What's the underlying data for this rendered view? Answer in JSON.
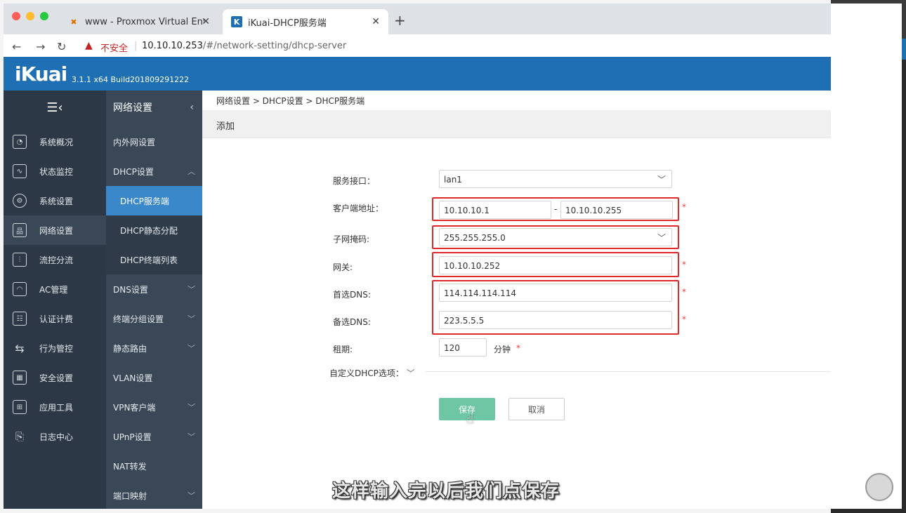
{
  "browser": {
    "tabs": [
      {
        "title": "www - Proxmox Virtual Environment",
        "active": false,
        "icon": "proxmox-icon"
      },
      {
        "title": "iKuai-DHCP服务端",
        "active": true,
        "icon": "ikuai-icon"
      }
    ],
    "insecure_label": "不安全",
    "url_host": "10.10.10.253",
    "url_path": "/#/network-setting/dhcp-server"
  },
  "app": {
    "logo": "iKuai",
    "version": "3.1.1 x64 Build201809291222"
  },
  "sidebar": {
    "main_items": [
      {
        "label": "系统概况",
        "icon": "speedometer-icon"
      },
      {
        "label": "状态监控",
        "icon": "pulse-icon"
      },
      {
        "label": "系统设置",
        "icon": "gear-icon"
      },
      {
        "label": "网络设置",
        "icon": "network-icon",
        "active": true
      },
      {
        "label": "流控分流",
        "icon": "sliders-icon"
      },
      {
        "label": "AC管理",
        "icon": "wifi-icon"
      },
      {
        "label": "认证计费",
        "icon": "id-card-icon"
      },
      {
        "label": "行为管控",
        "icon": "arrows-icon"
      },
      {
        "label": "安全设置",
        "icon": "firewall-icon"
      },
      {
        "label": "应用工具",
        "icon": "apps-icon"
      },
      {
        "label": "日志中心",
        "icon": "log-icon"
      }
    ],
    "sub_header": "网络设置",
    "sub_items": [
      {
        "label": "内外网设置"
      },
      {
        "label": "DHCP设置",
        "expanded": true
      },
      {
        "label": "DHCP服务端",
        "child": true,
        "selected": true
      },
      {
        "label": "DHCP静态分配",
        "child": true
      },
      {
        "label": "DHCP终端列表",
        "child": true
      },
      {
        "label": "DNS设置",
        "chevron": true
      },
      {
        "label": "终端分组设置",
        "chevron": true
      },
      {
        "label": "静态路由",
        "chevron": true
      },
      {
        "label": "VLAN设置"
      },
      {
        "label": "VPN客户端",
        "chevron": true
      },
      {
        "label": "UPnP设置",
        "chevron": true
      },
      {
        "label": "NAT转发"
      },
      {
        "label": "端口映射",
        "chevron": true
      }
    ]
  },
  "content": {
    "breadcrumb": "网络设置 > DHCP设置 > DHCP服务端",
    "section_title": "添加",
    "form": {
      "interface_label": "服务接口：",
      "interface_value": "lan1",
      "client_addr_label": "客户端地址：",
      "client_start": "10.10.10.1",
      "client_dash": "-",
      "client_end": "10.10.10.255",
      "subnet_label": "子网掩码:",
      "subnet_value": "255.255.255.0",
      "gateway_label": "网关:",
      "gateway_value": "10.10.10.252",
      "dns1_label": "首选DNS:",
      "dns1_value": "114.114.114.114",
      "dns2_label": "备选DNS:",
      "dns2_value": "223.5.5.5",
      "lease_label": "租期:",
      "lease_value": "120",
      "lease_unit": "分钟",
      "required_mark": "*",
      "custom_options_label": "自定义DHCP选项："
    },
    "save_label": "保存",
    "cancel_label": "取消"
  },
  "subtitle": "这样输入完以后我们点保存",
  "colors": {
    "header_blue": "#1e6fb3",
    "sidebar_dark": "#2c3845",
    "sidebar_sub": "#394756",
    "selected_blue": "#3a87c9",
    "save_green": "#6fc6a5",
    "highlight_red": "#e02a2a"
  }
}
